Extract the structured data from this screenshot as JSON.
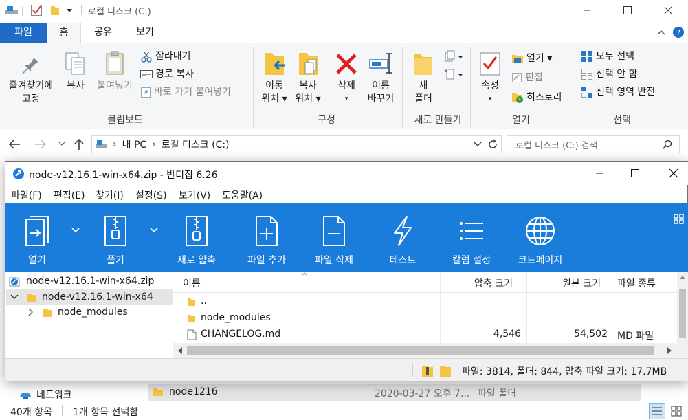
{
  "explorer": {
    "title": "로컬 디스크 (C:)",
    "tabs": {
      "file": "파일",
      "home": "홈",
      "share": "공유",
      "view": "보기"
    },
    "ribbon": {
      "pin_line1": "즐겨찾기에",
      "pin_line2": "고정",
      "copy": "복사",
      "paste": "붙여넣기",
      "cut": "잘라내기",
      "copy_path": "경로 복사",
      "paste_shortcut": "바로 가기 붙여넣기",
      "clipboard_group": "클립보드",
      "move_line1": "이동",
      "move_line2": "위치 ▾",
      "copyto_line1": "복사",
      "copyto_line2": "위치 ▾",
      "delete": "삭제",
      "rename_line1": "이름",
      "rename_line2": "바꾸기",
      "organize_group": "구성",
      "new_line1": "새",
      "new_line2": "폴더",
      "new_group": "새로 만들기",
      "properties": "속성",
      "open": "열기 ▾",
      "edit": "편집",
      "history": "히스토리",
      "open_group": "열기",
      "select_all": "모두 선택",
      "select_none": "선택 안 함",
      "invert_selection": "선택 영역 반전",
      "select_group": "선택"
    },
    "address": {
      "pc": "내 PC",
      "drive": "로컬 디스크 (C:)"
    },
    "search_placeholder": "로컬 디스크 (C:) 검색",
    "network": "네트워크",
    "bottom_row": {
      "name": "node1216",
      "date": "2020-03-27 오후 7...",
      "type": "파일 폴더"
    },
    "status": {
      "count": "40개 항목",
      "selected": "1개 항목 선택함"
    }
  },
  "bandizip": {
    "title": "node-v12.16.1-win-x64.zip - 반디집 6.26",
    "menu": [
      "파일(F)",
      "편집(E)",
      "찾기(I)",
      "설정(S)",
      "보기(V)",
      "도움말(A)"
    ],
    "toolbar": {
      "open": "열기",
      "extract": "풀기",
      "new_archive": "새로 압축",
      "add_file": "파일 추가",
      "delete_file": "파일 삭제",
      "test": "테스트",
      "columns": "칼럼 설정",
      "codepage": "코드페이지"
    },
    "tree": {
      "archive": "node-v12.16.1-win-x64.zip",
      "root_folder": "node-v12.16.1-win-x64",
      "child_folder": "node_modules"
    },
    "columns": {
      "name": "이름",
      "packed": "압축 크기",
      "original": "원본 크기",
      "type": "파일 종류"
    },
    "rows": [
      {
        "name": "..",
        "packed": "",
        "original": "",
        "type": ""
      },
      {
        "name": "node_modules",
        "packed": "",
        "original": "",
        "type": ""
      },
      {
        "name": "CHANGELOG.md",
        "packed": "4,546",
        "original": "54,502",
        "type": "MD 파일"
      }
    ],
    "status": "파일: 3814, 폴더: 844, 압축 파일 크기: 17.7MB"
  },
  "colors": {
    "accent": "#1f6bc6",
    "toolbar": "#1a7ddc",
    "folder": "#f5c542"
  }
}
